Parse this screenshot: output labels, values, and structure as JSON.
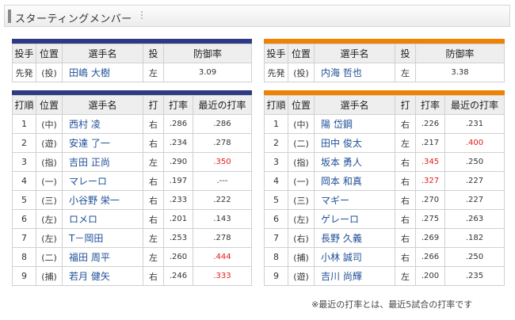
{
  "header": {
    "title": "スターティングメンバー"
  },
  "pitchers": {
    "columns": [
      "投手",
      "位置",
      "選手名",
      "投",
      "防御率"
    ],
    "left": {
      "role": "先発",
      "pos": "(投)",
      "name": "田嶋 大樹",
      "hand": "左",
      "era": "3.09"
    },
    "right": {
      "role": "先発",
      "pos": "(投)",
      "name": "内海 哲也",
      "hand": "左",
      "era": "3.38"
    }
  },
  "lineup_columns": [
    "打順",
    "位置",
    "選手名",
    "打",
    "打率",
    "最近の打率"
  ],
  "lineup_left": [
    {
      "order": "1",
      "pos": "(中)",
      "name": "西村 凌",
      "bat": "右",
      "avg": ".286",
      "recent": ".286",
      "recent_red": false,
      "avg_red": false
    },
    {
      "order": "2",
      "pos": "(遊)",
      "name": "安達 了一",
      "bat": "右",
      "avg": ".234",
      "recent": ".278",
      "recent_red": false,
      "avg_red": false
    },
    {
      "order": "3",
      "pos": "(指)",
      "name": "吉田 正尚",
      "bat": "左",
      "avg": ".290",
      "recent": ".350",
      "recent_red": true,
      "avg_red": false
    },
    {
      "order": "4",
      "pos": "(一)",
      "name": "マレーロ",
      "bat": "右",
      "avg": ".197",
      "recent": ".---",
      "recent_red": false,
      "avg_red": false
    },
    {
      "order": "5",
      "pos": "(三)",
      "name": "小谷野 栄一",
      "bat": "右",
      "avg": ".233",
      "recent": ".222",
      "recent_red": false,
      "avg_red": false
    },
    {
      "order": "6",
      "pos": "(左)",
      "name": "ロメロ",
      "bat": "右",
      "avg": ".201",
      "recent": ".143",
      "recent_red": false,
      "avg_red": false
    },
    {
      "order": "7",
      "pos": "(左)",
      "name": "T－岡田",
      "bat": "左",
      "avg": ".253",
      "recent": ".278",
      "recent_red": false,
      "avg_red": false
    },
    {
      "order": "8",
      "pos": "(二)",
      "name": "福田 周平",
      "bat": "左",
      "avg": ".260",
      "recent": ".444",
      "recent_red": true,
      "avg_red": false
    },
    {
      "order": "9",
      "pos": "(捕)",
      "name": "若月 健矢",
      "bat": "右",
      "avg": ".246",
      "recent": ".333",
      "recent_red": true,
      "avg_red": false
    }
  ],
  "lineup_right": [
    {
      "order": "1",
      "pos": "(中)",
      "name": "陽 岱鋼",
      "bat": "右",
      "avg": ".226",
      "recent": ".231",
      "recent_red": false,
      "avg_red": false
    },
    {
      "order": "2",
      "pos": "(二)",
      "name": "田中 俊太",
      "bat": "左",
      "avg": ".217",
      "recent": ".400",
      "recent_red": true,
      "avg_red": false
    },
    {
      "order": "3",
      "pos": "(指)",
      "name": "坂本 勇人",
      "bat": "右",
      "avg": ".345",
      "recent": ".250",
      "recent_red": false,
      "avg_red": true
    },
    {
      "order": "4",
      "pos": "(一)",
      "name": "岡本 和真",
      "bat": "右",
      "avg": ".327",
      "recent": ".227",
      "recent_red": false,
      "avg_red": true
    },
    {
      "order": "5",
      "pos": "(三)",
      "name": "マギー",
      "bat": "右",
      "avg": ".270",
      "recent": ".227",
      "recent_red": false,
      "avg_red": false
    },
    {
      "order": "6",
      "pos": "(左)",
      "name": "ゲレーロ",
      "bat": "右",
      "avg": ".275",
      "recent": ".263",
      "recent_red": false,
      "avg_red": false
    },
    {
      "order": "7",
      "pos": "(右)",
      "name": "長野 久義",
      "bat": "右",
      "avg": ".269",
      "recent": ".182",
      "recent_red": false,
      "avg_red": false
    },
    {
      "order": "8",
      "pos": "(捕)",
      "name": "小林 誠司",
      "bat": "右",
      "avg": ".266",
      "recent": ".250",
      "recent_red": false,
      "avg_red": false
    },
    {
      "order": "9",
      "pos": "(遊)",
      "name": "吉川 尚輝",
      "bat": "左",
      "avg": ".200",
      "recent": ".235",
      "recent_red": false,
      "avg_red": false
    }
  ],
  "footnote": "※最近の打率とは、最近5試合の打率です",
  "colors": {
    "home_accent": "#2e3a83",
    "away_accent": "#ef8200",
    "player_link": "#1f4f97",
    "highlight": "#e81a1a"
  }
}
